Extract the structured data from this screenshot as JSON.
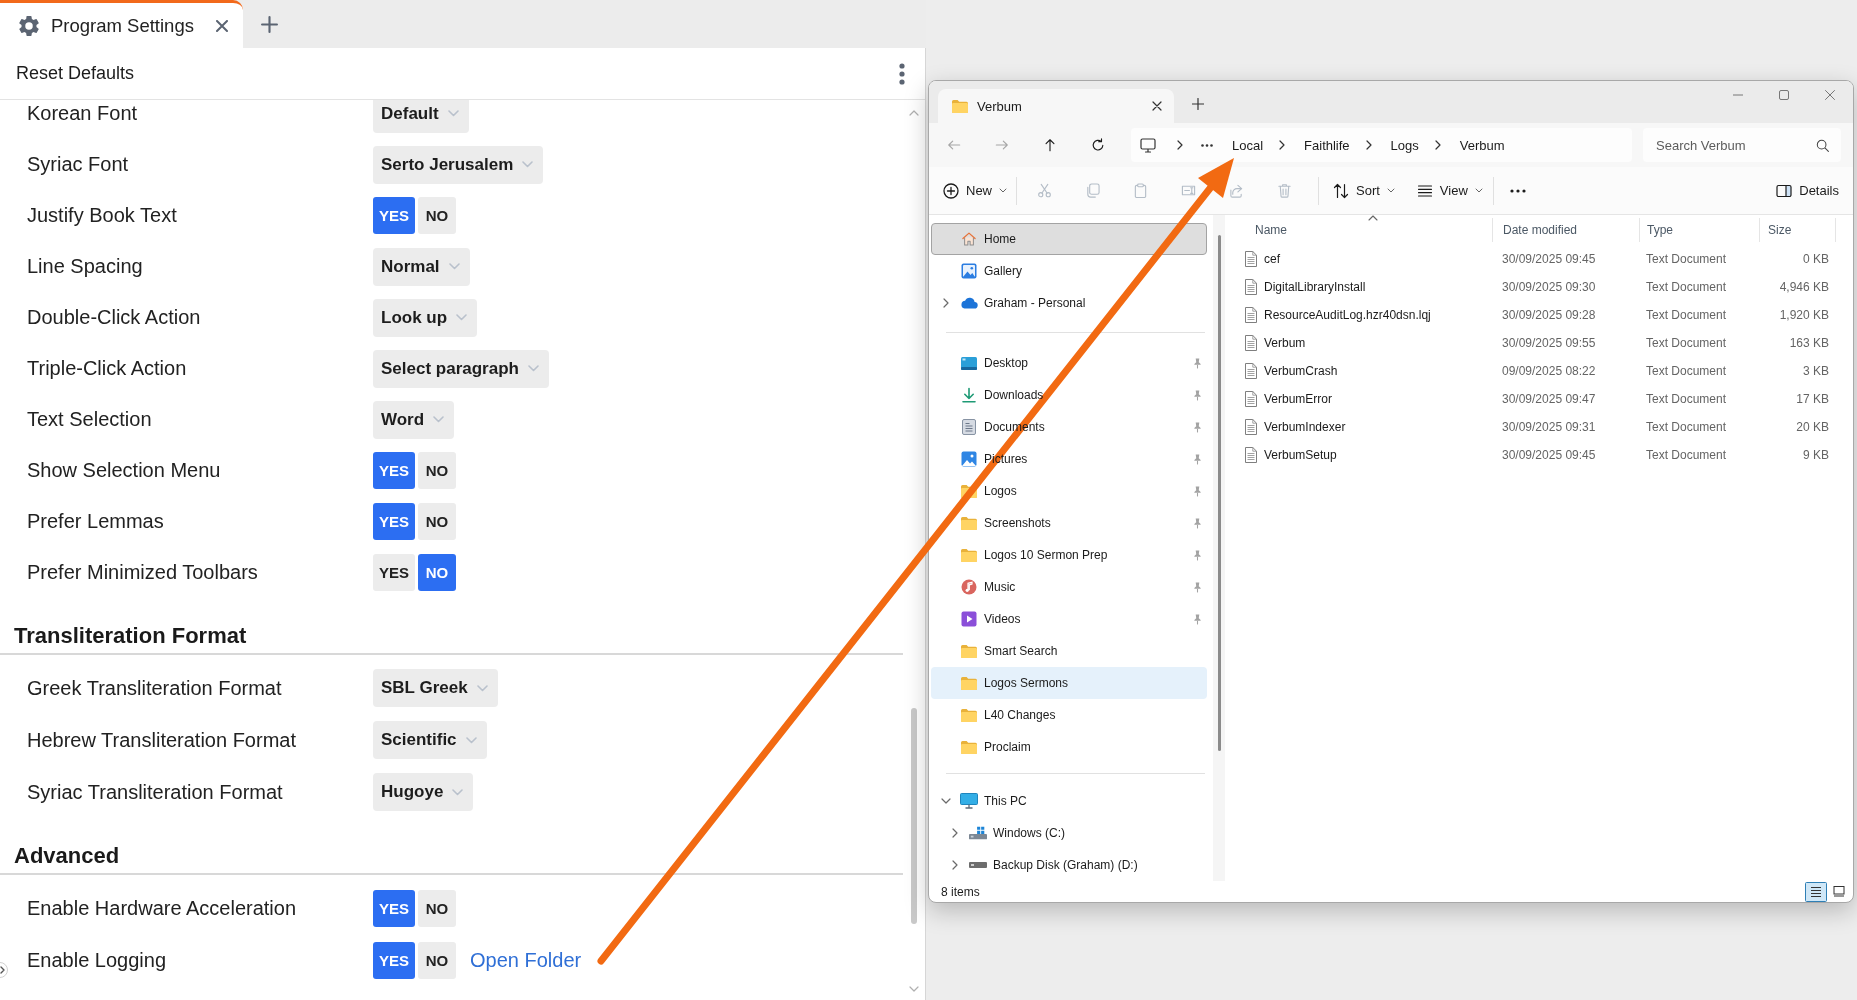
{
  "app_tabs": [
    {
      "label": "Program Settings",
      "selected": true
    }
  ],
  "settings": {
    "reset_button": "Reset Defaults",
    "sections": [
      {
        "rows": [
          {
            "kind": "dropdown",
            "label": "Korean Font",
            "value": "Default"
          },
          {
            "kind": "dropdown",
            "label": "Syriac Font",
            "value": "Serto Jerusalem"
          },
          {
            "kind": "toggle",
            "label": "Justify Book Text",
            "options": [
              {
                "label": "YES",
                "selected": true
              },
              {
                "label": "NO",
                "selected": false
              }
            ]
          },
          {
            "kind": "dropdown",
            "label": "Line Spacing",
            "value": "Normal"
          },
          {
            "kind": "dropdown",
            "label": "Double-Click Action",
            "value": "Look up"
          },
          {
            "kind": "dropdown",
            "label": "Triple-Click Action",
            "value": "Select paragraph"
          },
          {
            "kind": "dropdown",
            "label": "Text Selection",
            "value": "Word"
          },
          {
            "kind": "toggle",
            "label": "Show Selection Menu",
            "options": [
              {
                "label": "YES",
                "selected": true
              },
              {
                "label": "NO",
                "selected": false
              }
            ]
          },
          {
            "kind": "toggle",
            "label": "Prefer Lemmas",
            "options": [
              {
                "label": "YES",
                "selected": true
              },
              {
                "label": "NO",
                "selected": false
              }
            ]
          },
          {
            "kind": "toggle",
            "label": "Prefer Minimized Toolbars",
            "options": [
              {
                "label": "YES",
                "selected": false
              },
              {
                "label": "NO",
                "selected": true
              }
            ]
          }
        ]
      },
      {
        "heading": "Transliteration Format",
        "rows": [
          {
            "kind": "dropdown",
            "label": "Greek Transliteration Format",
            "value": "SBL Greek"
          },
          {
            "kind": "dropdown",
            "label": "Hebrew Transliteration Format",
            "value": "Scientific"
          },
          {
            "kind": "dropdown",
            "label": "Syriac Transliteration Format",
            "value": "Hugoye"
          }
        ]
      },
      {
        "heading": "Advanced",
        "rows": [
          {
            "kind": "toggle",
            "label": "Enable Hardware Acceleration",
            "options": [
              {
                "label": "YES",
                "selected": true
              },
              {
                "label": "NO",
                "selected": false
              }
            ]
          },
          {
            "kind": "toggle",
            "label": "Enable Logging",
            "options": [
              {
                "label": "YES",
                "selected": true
              },
              {
                "label": "NO",
                "selected": false
              }
            ],
            "link": "Open Folder"
          }
        ]
      }
    ]
  },
  "explorer": {
    "tabs": [
      {
        "title": "Verbum",
        "selected": true
      }
    ],
    "nav": [
      {
        "kind": "back",
        "disabled": true
      },
      {
        "kind": "forward",
        "disabled": true
      },
      {
        "kind": "up",
        "disabled": false
      },
      {
        "kind": "refresh",
        "disabled": false
      }
    ],
    "breadcrumb": [
      "Local",
      "Faithlife",
      "Logs",
      "Verbum"
    ],
    "search": {
      "placeholder": "Search Verbum"
    },
    "commands": [
      {
        "kind": "new",
        "label": "New",
        "disabled": false
      },
      {
        "kind": "cut",
        "disabled": true
      },
      {
        "kind": "copy",
        "disabled": true
      },
      {
        "kind": "paste",
        "disabled": true
      },
      {
        "kind": "rename",
        "disabled": true
      },
      {
        "kind": "share",
        "disabled": true
      },
      {
        "kind": "delete",
        "disabled": true
      },
      {
        "kind": "sort",
        "label": "Sort",
        "disabled": false
      },
      {
        "kind": "view",
        "label": "View",
        "disabled": false
      },
      {
        "kind": "more",
        "disabled": false
      }
    ],
    "details_button": "Details",
    "sidebar": [
      [
        {
          "kind": "home",
          "label": "Home",
          "selected": true,
          "hovered": false,
          "pinned": false
        },
        {
          "kind": "gallery",
          "label": "Gallery",
          "selected": false,
          "hovered": false,
          "pinned": false
        },
        {
          "kind": "cloud",
          "label": "Graham - Personal",
          "selected": false,
          "hovered": false,
          "pinned": false,
          "expanded": false
        }
      ],
      [
        {
          "kind": "desktop",
          "label": "Desktop",
          "selected": false,
          "hovered": false,
          "pinned": true
        },
        {
          "kind": "downloads",
          "label": "Downloads",
          "selected": false,
          "hovered": false,
          "pinned": true
        },
        {
          "kind": "documents",
          "label": "Documents",
          "selected": false,
          "hovered": false,
          "pinned": true
        },
        {
          "kind": "pictures",
          "label": "Pictures",
          "selected": false,
          "hovered": false,
          "pinned": true
        },
        {
          "kind": "folder",
          "label": "Logos",
          "selected": false,
          "hovered": false,
          "pinned": true
        },
        {
          "kind": "folder",
          "label": "Screenshots",
          "selected": false,
          "hovered": false,
          "pinned": true
        },
        {
          "kind": "folder",
          "label": "Logos 10 Sermon Prep",
          "selected": false,
          "hovered": false,
          "pinned": true
        },
        {
          "kind": "music",
          "label": "Music",
          "selected": false,
          "hovered": false,
          "pinned": true
        },
        {
          "kind": "videos",
          "label": "Videos",
          "selected": false,
          "hovered": false,
          "pinned": true
        },
        {
          "kind": "folder",
          "label": "Smart Search",
          "selected": false,
          "hovered": false,
          "pinned": false
        },
        {
          "kind": "folder",
          "label": "Logos Sermons",
          "selected": false,
          "hovered": true,
          "pinned": false
        },
        {
          "kind": "folder",
          "label": "L40 Changes",
          "selected": false,
          "hovered": false,
          "pinned": false
        },
        {
          "kind": "folder",
          "label": "Proclaim",
          "selected": false,
          "hovered": false,
          "pinned": false
        }
      ],
      [
        {
          "kind": "pc",
          "label": "This PC",
          "selected": false,
          "hovered": false,
          "pinned": false,
          "expanded": true,
          "children": [
            {
              "kind": "windows_drive",
              "label": "Windows (C:)",
              "selected": false,
              "hovered": false,
              "pinned": false,
              "expanded": false
            },
            {
              "kind": "drive",
              "label": "Backup Disk (Graham) (D:)",
              "selected": false,
              "hovered": false,
              "pinned": false,
              "expanded": false
            }
          ]
        }
      ]
    ],
    "columns": [
      {
        "label": "Name",
        "sorted": true
      },
      {
        "label": "Date modified",
        "sorted": false
      },
      {
        "label": "Type",
        "sorted": false
      },
      {
        "label": "Size",
        "sorted": false
      }
    ],
    "files": [
      {
        "name": "cef",
        "date_modified": "30/09/2025 09:45",
        "type": "Text Document",
        "size": "0 KB"
      },
      {
        "name": "DigitalLibraryInstall",
        "date_modified": "30/09/2025 09:30",
        "type": "Text Document",
        "size": "4,946 KB"
      },
      {
        "name": "ResourceAuditLog.hzr40dsn.lqj",
        "date_modified": "30/09/2025 09:28",
        "type": "Text Document",
        "size": "1,920 KB"
      },
      {
        "name": "Verbum",
        "date_modified": "30/09/2025 09:55",
        "type": "Text Document",
        "size": "163 KB"
      },
      {
        "name": "VerbumCrash",
        "date_modified": "09/09/2025 08:22",
        "type": "Text Document",
        "size": "3 KB"
      },
      {
        "name": "VerbumError",
        "date_modified": "30/09/2025 09:47",
        "type": "Text Document",
        "size": "17 KB"
      },
      {
        "name": "VerbumIndexer",
        "date_modified": "30/09/2025 09:31",
        "type": "Text Document",
        "size": "20 KB"
      },
      {
        "name": "VerbumSetup",
        "date_modified": "30/09/2025 09:45",
        "type": "Text Document",
        "size": "9 KB"
      }
    ],
    "status": "8 items",
    "views": [
      {
        "kind": "details",
        "selected": true
      },
      {
        "kind": "tiles",
        "selected": false
      }
    ]
  }
}
